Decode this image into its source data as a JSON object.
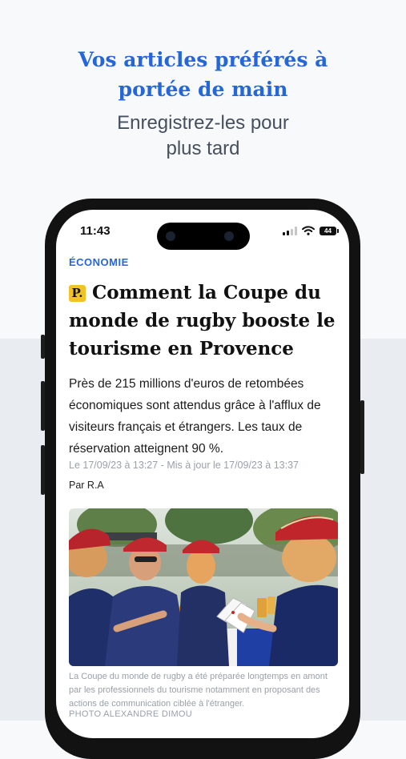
{
  "promo": {
    "title_line1": "Vos articles préférés à",
    "title_line2": "portée de main",
    "subtitle_line1": "Enregistrez-les pour",
    "subtitle_line2": "plus tard"
  },
  "status_bar": {
    "time": "11:43",
    "battery": "44"
  },
  "article": {
    "category": "ÉCONOMIE",
    "premium_badge": "P.",
    "headline": "Comment la Coupe du monde de rugby booste le tourisme en Provence",
    "chapo": "Près de 215 millions d'euros de retombées économiques sont attendus grâce à l'afflux de visiteurs français et étrangers. Les taux de réservation atteignent 90 %.",
    "dateline": "Le 17/09/23 à 13:27 - Mis à jour le 17/09/23 à 13:37",
    "author": "Par R.A",
    "photo_caption": "La Coupe du monde de rugby a été préparée longtemps en amont par les professionnels du tourisme notamment en proposant des actions de communication ciblée à l'étranger.",
    "photo_credit": "PHOTO ALEXANDRE DIMOU"
  },
  "colors": {
    "accent_blue": "#2566d8",
    "premium_yellow": "#f3c225",
    "subtitle_gray": "#454f5e",
    "meta_gray": "#9aa0a8"
  },
  "icons": [
    "signal-icon",
    "wifi-icon",
    "battery-icon",
    "premium-badge-icon"
  ]
}
